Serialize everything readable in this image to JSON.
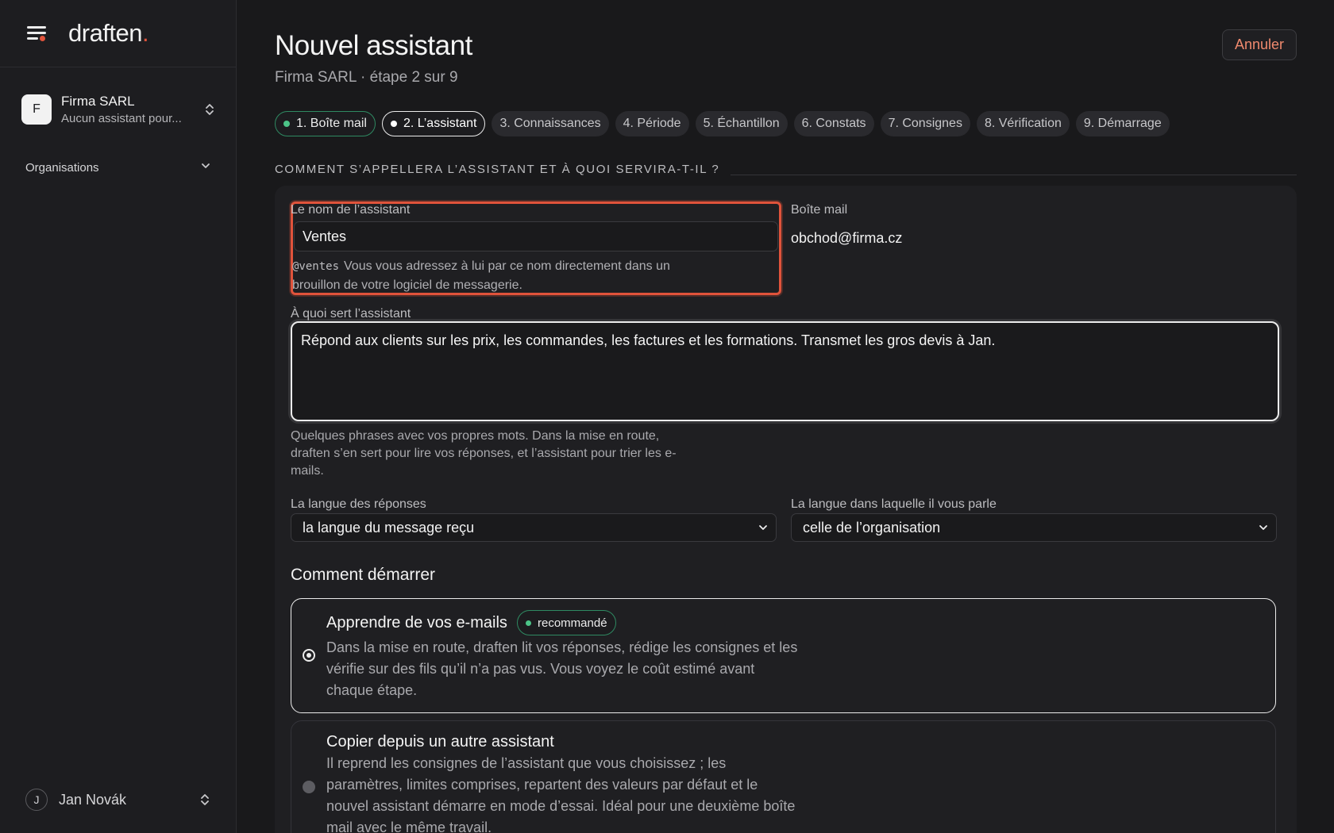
{
  "sidebar": {
    "logo_text": "draften",
    "logo_dot": ".",
    "org": {
      "initial": "F",
      "name": "Firma SARL",
      "subtitle": "Aucun assistant pour..."
    },
    "nav_label": "Organisations",
    "user": {
      "initial": "J",
      "name": "Jan Novák"
    }
  },
  "header": {
    "title": "Nouvel assistant",
    "subtitle": "Firma SARL · étape 2 sur 9",
    "cancel_label": "Annuler"
  },
  "steps": [
    {
      "label": "1. Boîte mail",
      "state": "done"
    },
    {
      "label": "2. L’assistant",
      "state": "active"
    },
    {
      "label": "3. Connaissances",
      "state": "todo"
    },
    {
      "label": "4. Période",
      "state": "todo"
    },
    {
      "label": "5. Échantillon",
      "state": "todo"
    },
    {
      "label": "6. Constats",
      "state": "todo"
    },
    {
      "label": "7. Consignes",
      "state": "todo"
    },
    {
      "label": "8. Vérification",
      "state": "todo"
    },
    {
      "label": "9. Démarrage",
      "state": "todo"
    }
  ],
  "section": {
    "heading": "COMMENT S’APPELLERA L’ASSISTANT ET À QUOI SERVIRA-T-IL ?"
  },
  "form": {
    "name_label": "Le nom de l’assistant",
    "name_value": "Ventes",
    "name_handle": "@ventes",
    "name_help": "Vous vous adressez à lui par ce nom directement dans un brouillon de votre logiciel de messagerie.",
    "mailbox_label": "Boîte mail",
    "mailbox_value": "obchod@firma.cz",
    "purpose_label": "À quoi sert l’assistant",
    "purpose_value": "Répond aux clients sur les prix, les commandes, les factures et les formations. Transmet les gros devis à Jan.",
    "purpose_help": "Quelques phrases avec vos propres mots. Dans la mise en route, draften s’en sert pour lire vos réponses, et l’assistant pour trier les e-mails.",
    "reply_lang_label": "La langue des réponses",
    "reply_lang_value": "la langue du message reçu",
    "talk_lang_label": "La langue dans laquelle il vous parle",
    "talk_lang_value": "celle de l’organisation"
  },
  "start": {
    "title": "Comment démarrer",
    "options": [
      {
        "title": "Apprendre de vos e-mails",
        "badge": "recommandé",
        "desc": "Dans la mise en route, draften lit vos réponses, rédige les consignes et les vérifie sur des fils qu’il n’a pas vus. Vous voyez le coût estimé avant chaque étape.",
        "selected": true
      },
      {
        "title": "Copier depuis un autre assistant",
        "desc": "Il reprend les consignes de l’assistant que vous choisissez ; les paramètres, limites comprises, repartent des valeurs par défaut et le nouvel assistant démarre en mode d’essai. Idéal pour une deuxième boîte mail avec le même travail.",
        "selected": false
      }
    ]
  },
  "colors": {
    "accent": "#e0533b",
    "success": "#4cc488",
    "background": "#19191b"
  }
}
